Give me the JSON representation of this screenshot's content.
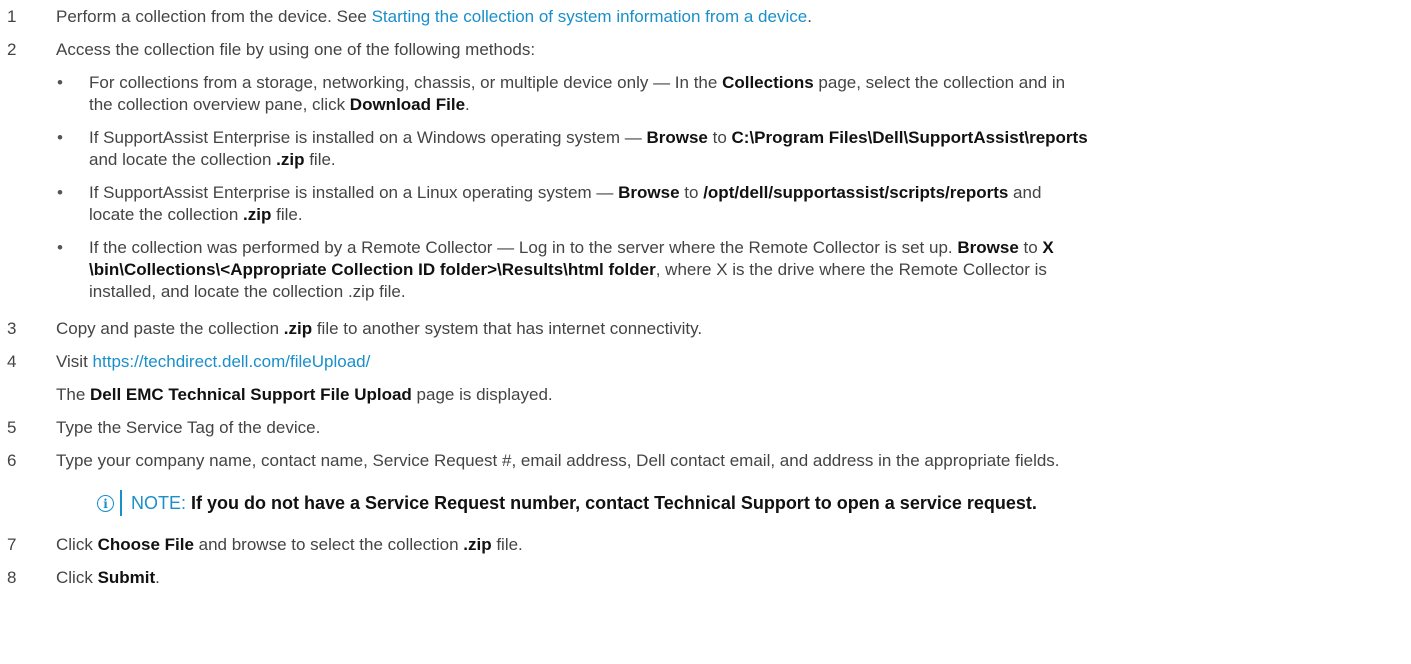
{
  "steps": [
    {
      "num": "1",
      "pre": "Perform a collection from the device. See ",
      "link": "Starting the collection of system information from a device",
      "post": "."
    },
    {
      "num": "2",
      "text": "Access the collection file by using one of the following methods:"
    },
    {
      "num": "3",
      "pre": "Copy and paste the collection ",
      "bold": ".zip",
      "post": " file to another system that has internet connectivity."
    },
    {
      "num": "4",
      "pre": "Visit ",
      "link": "https://techdirect.dell.com/fileUpload/"
    },
    {
      "num": "5",
      "text": "Type the Service Tag of the device."
    },
    {
      "num": "6",
      "text": "Type your company name, contact name, Service Request #, email address, Dell contact email, and address in the appropriate fields."
    },
    {
      "num": "7",
      "pre": "Click ",
      "bold": "Choose File",
      "mid": " and browse to select the collection ",
      "bold2": ".zip",
      "post": " file."
    },
    {
      "num": "8",
      "pre": "Click ",
      "bold": "Submit",
      "post": "."
    }
  ],
  "step4_result": {
    "pre": "The ",
    "bold": "Dell EMC Technical Support File Upload",
    "post": " page is displayed."
  },
  "bullets": {
    "b1": {
      "a": "For collections from a storage, networking, chassis, or multiple device only — In the ",
      "b": "Collections",
      "c": " page, select the collection and in",
      "d": "the collection overview pane, click ",
      "e": "Download File",
      "f": "."
    },
    "b2": {
      "a": "If SupportAssist Enterprise is installed on a Windows operating system — ",
      "b": "Browse",
      "c": " to ",
      "d": "C:\\Program Files\\Dell\\SupportAssist\\reports",
      "e": "and locate the collection ",
      "f": ".zip",
      "g": " file."
    },
    "b3": {
      "a": "If SupportAssist Enterprise is installed on a Linux operating system — ",
      "b": "Browse",
      "c": " to ",
      "d": "/opt/dell/supportassist/scripts/reports",
      "e": " and",
      "f": "locate the collection ",
      "g": ".zip",
      "h": " file."
    },
    "b4": {
      "a": "If the collection was performed by a Remote Collector — Log in to the server where the Remote Collector is set up. ",
      "b": "Browse",
      "c": " to ",
      "d": "X",
      "e": "\\bin\\Collections\\<Appropriate Collection ID folder>\\Results\\html folder",
      "f": ", where X is the drive where the Remote Collector is",
      "g": "installed, and locate the collection .zip file."
    }
  },
  "note": {
    "icon": "info-circle-icon",
    "label": "NOTE:",
    "text": " If you do not have a Service Request number, contact Technical Support to open a service request."
  },
  "colors": {
    "link": "#1a8fc9",
    "text": "#444444"
  }
}
